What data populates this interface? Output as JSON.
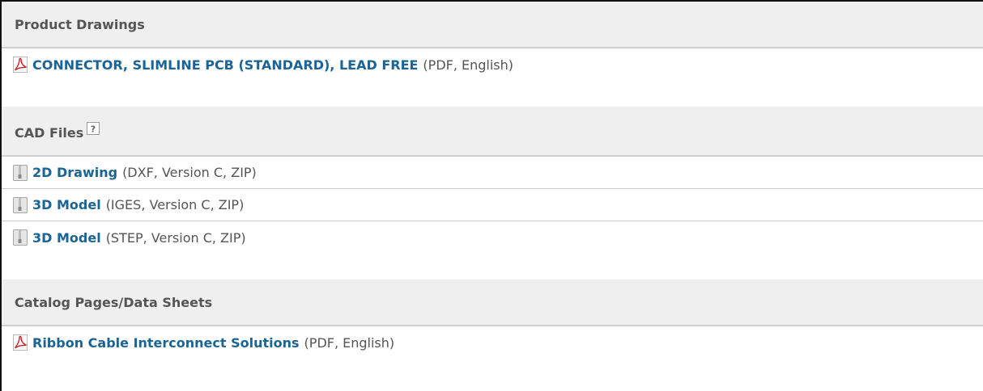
{
  "sections": {
    "product_drawings": {
      "title": "Product Drawings",
      "items": [
        {
          "icon": "pdf-icon",
          "link": "CONNECTOR, SLIMLINE PCB (STANDARD), LEAD FREE",
          "meta": "(PDF, English)"
        }
      ]
    },
    "cad_files": {
      "title": "CAD Files",
      "help_icon": "help-icon",
      "items": [
        {
          "icon": "zip-file-icon",
          "link": "2D Drawing",
          "meta": "(DXF, Version C, ZIP)"
        },
        {
          "icon": "zip-file-icon",
          "link": "3D Model",
          "meta": "(IGES, Version C, ZIP)"
        },
        {
          "icon": "zip-file-icon",
          "link": "3D Model",
          "meta": "(STEP, Version C, ZIP)"
        }
      ]
    },
    "catalog_pages": {
      "title": "Catalog Pages/Data Sheets",
      "items": [
        {
          "icon": "pdf-icon",
          "link": "Ribbon Cable Interconnect Solutions",
          "meta": "(PDF, English)"
        }
      ]
    }
  },
  "colors": {
    "link": "#1a6496",
    "header_bg": "#efefef",
    "text": "#555555",
    "pdf_red": "#cc2222"
  }
}
